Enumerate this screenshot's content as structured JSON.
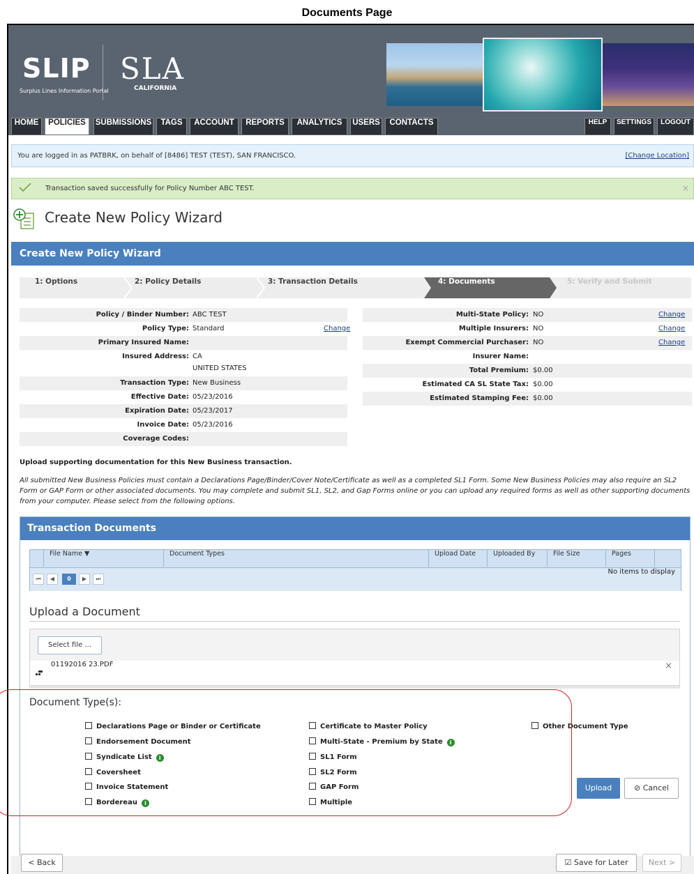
{
  "caption": "Documents Page",
  "brand": {
    "slip_text": "SLIP",
    "slip_sub": "Surplus Lines Information Portal",
    "sla_text": "SLA",
    "sla_sub": "CALIFORNIA"
  },
  "nav": {
    "tabs": [
      "HOME",
      "POLICIES",
      "SUBMISSIONS",
      "TAGS",
      "ACCOUNT",
      "REPORTS",
      "ANALYTICS",
      "USERS",
      "CONTACTS"
    ],
    "active": "POLICIES",
    "right_tabs": [
      "HELP",
      "SETTINGS",
      "LOGOUT"
    ]
  },
  "login_bar": {
    "text": "You are logged in as PATBRK, on behalf of [8486] TEST (TEST), SAN FRANCISCO.",
    "change_location": "[Change Location]"
  },
  "success_bar": {
    "text": "Transaction saved successfully for Policy Number ABC TEST.",
    "close": "×"
  },
  "page_title": "Create New Policy Wizard",
  "wizard": {
    "header": "Create New Policy Wizard",
    "steps": [
      "1: Options",
      "2: Policy Details",
      "3: Transaction Details",
      "4: Documents",
      "5: Verify and Submit"
    ],
    "active_step": "4: Documents"
  },
  "details_left": [
    {
      "label": "Policy / Binder Number:",
      "value": "ABC TEST",
      "action": ""
    },
    {
      "label": "Policy Type:",
      "value": "Standard",
      "action": "Change"
    },
    {
      "label": "Primary Insured Name:",
      "value": "",
      "action": ""
    },
    {
      "label": "Insured Address:",
      "value": "CA",
      "value2": "UNITED STATES",
      "action": ""
    },
    {
      "label": "Transaction Type:",
      "value": "New Business",
      "action": ""
    },
    {
      "label": "Effective Date:",
      "value": "05/23/2016",
      "action": ""
    },
    {
      "label": "Expiration Date:",
      "value": "05/23/2017",
      "action": ""
    },
    {
      "label": "Invoice Date:",
      "value": "05/23/2016",
      "action": ""
    },
    {
      "label": "Coverage Codes:",
      "value": "",
      "action": ""
    }
  ],
  "details_right": [
    {
      "label": "Multi-State Policy:",
      "value": "NO",
      "action": "Change"
    },
    {
      "label": "Multiple Insurers:",
      "value": "NO",
      "action": "Change"
    },
    {
      "label": "Exempt Commercial Purchaser:",
      "value": "NO",
      "action": "Change"
    },
    {
      "label": "Insurer Name:",
      "value": "",
      "action": ""
    },
    {
      "label": "Total Premium:",
      "value": "$0.00",
      "action": ""
    },
    {
      "label": "Estimated CA SL State Tax:",
      "value": "$0.00",
      "action": ""
    },
    {
      "label": "Estimated Stamping Fee:",
      "value": "$0.00",
      "action": ""
    }
  ],
  "intro": "Upload supporting documentation for this New Business transaction.",
  "intro_para": "All submitted New Business Policies must contain a Declarations Page/Binder/Cover Note/Certificate as well as a completed SL1 Form. Some New Business Policies may also require an SL2 Form or GAP Form or other associated documents. You may complete and submit SL1, SL2, and Gap Forms online or you can upload any required forms as well as other supporting documents from your computer. Please select from the following options.",
  "transaction_docs": {
    "header": "Transaction Documents",
    "columns": [
      "File Name ▼",
      "Document Types",
      "Upload Date",
      "Uploaded By",
      "File Size",
      "Pages"
    ],
    "pager": {
      "first": "⏮",
      "prev": "◀",
      "current": "0",
      "next": "▶",
      "last": "⏭"
    },
    "empty": "No items to display"
  },
  "upload": {
    "title": "Upload a Document",
    "select_file": "Select file ...",
    "file_name": "01192016 23.PDF",
    "remove": "×"
  },
  "doc_types": {
    "title": "Document Type(s):",
    "col1": [
      {
        "label": "Declarations Page or Binder or Certificate",
        "info": false
      },
      {
        "label": "Endorsement Document",
        "info": false
      },
      {
        "label": "Syndicate List",
        "info": true
      },
      {
        "label": "Coversheet",
        "info": false
      },
      {
        "label": "Invoice Statement",
        "info": false
      },
      {
        "label": "Bordereau",
        "info": true
      }
    ],
    "col2": [
      {
        "label": "Certificate to Master Policy",
        "info": false
      },
      {
        "label": "Multi-State - Premium by State",
        "info": true
      },
      {
        "label": "SL1 Form",
        "info": false
      },
      {
        "label": "SL2 Form",
        "info": false
      },
      {
        "label": "GAP Form",
        "info": false
      },
      {
        "label": "Multiple",
        "info": false
      }
    ],
    "col3": [
      {
        "label": "Other Document Type",
        "info": false
      }
    ],
    "upload_btn": "Upload",
    "cancel_btn": "Cancel"
  },
  "footer": {
    "back": "Back",
    "save_for_later": "Save for Later",
    "next": "Next"
  },
  "colors": {
    "header_bg": "#5a6470",
    "panel_blue": "#4a80be",
    "success_bg": "#d9edc7",
    "info_bg": "#e5f1fb",
    "highlight": "#d02020"
  }
}
